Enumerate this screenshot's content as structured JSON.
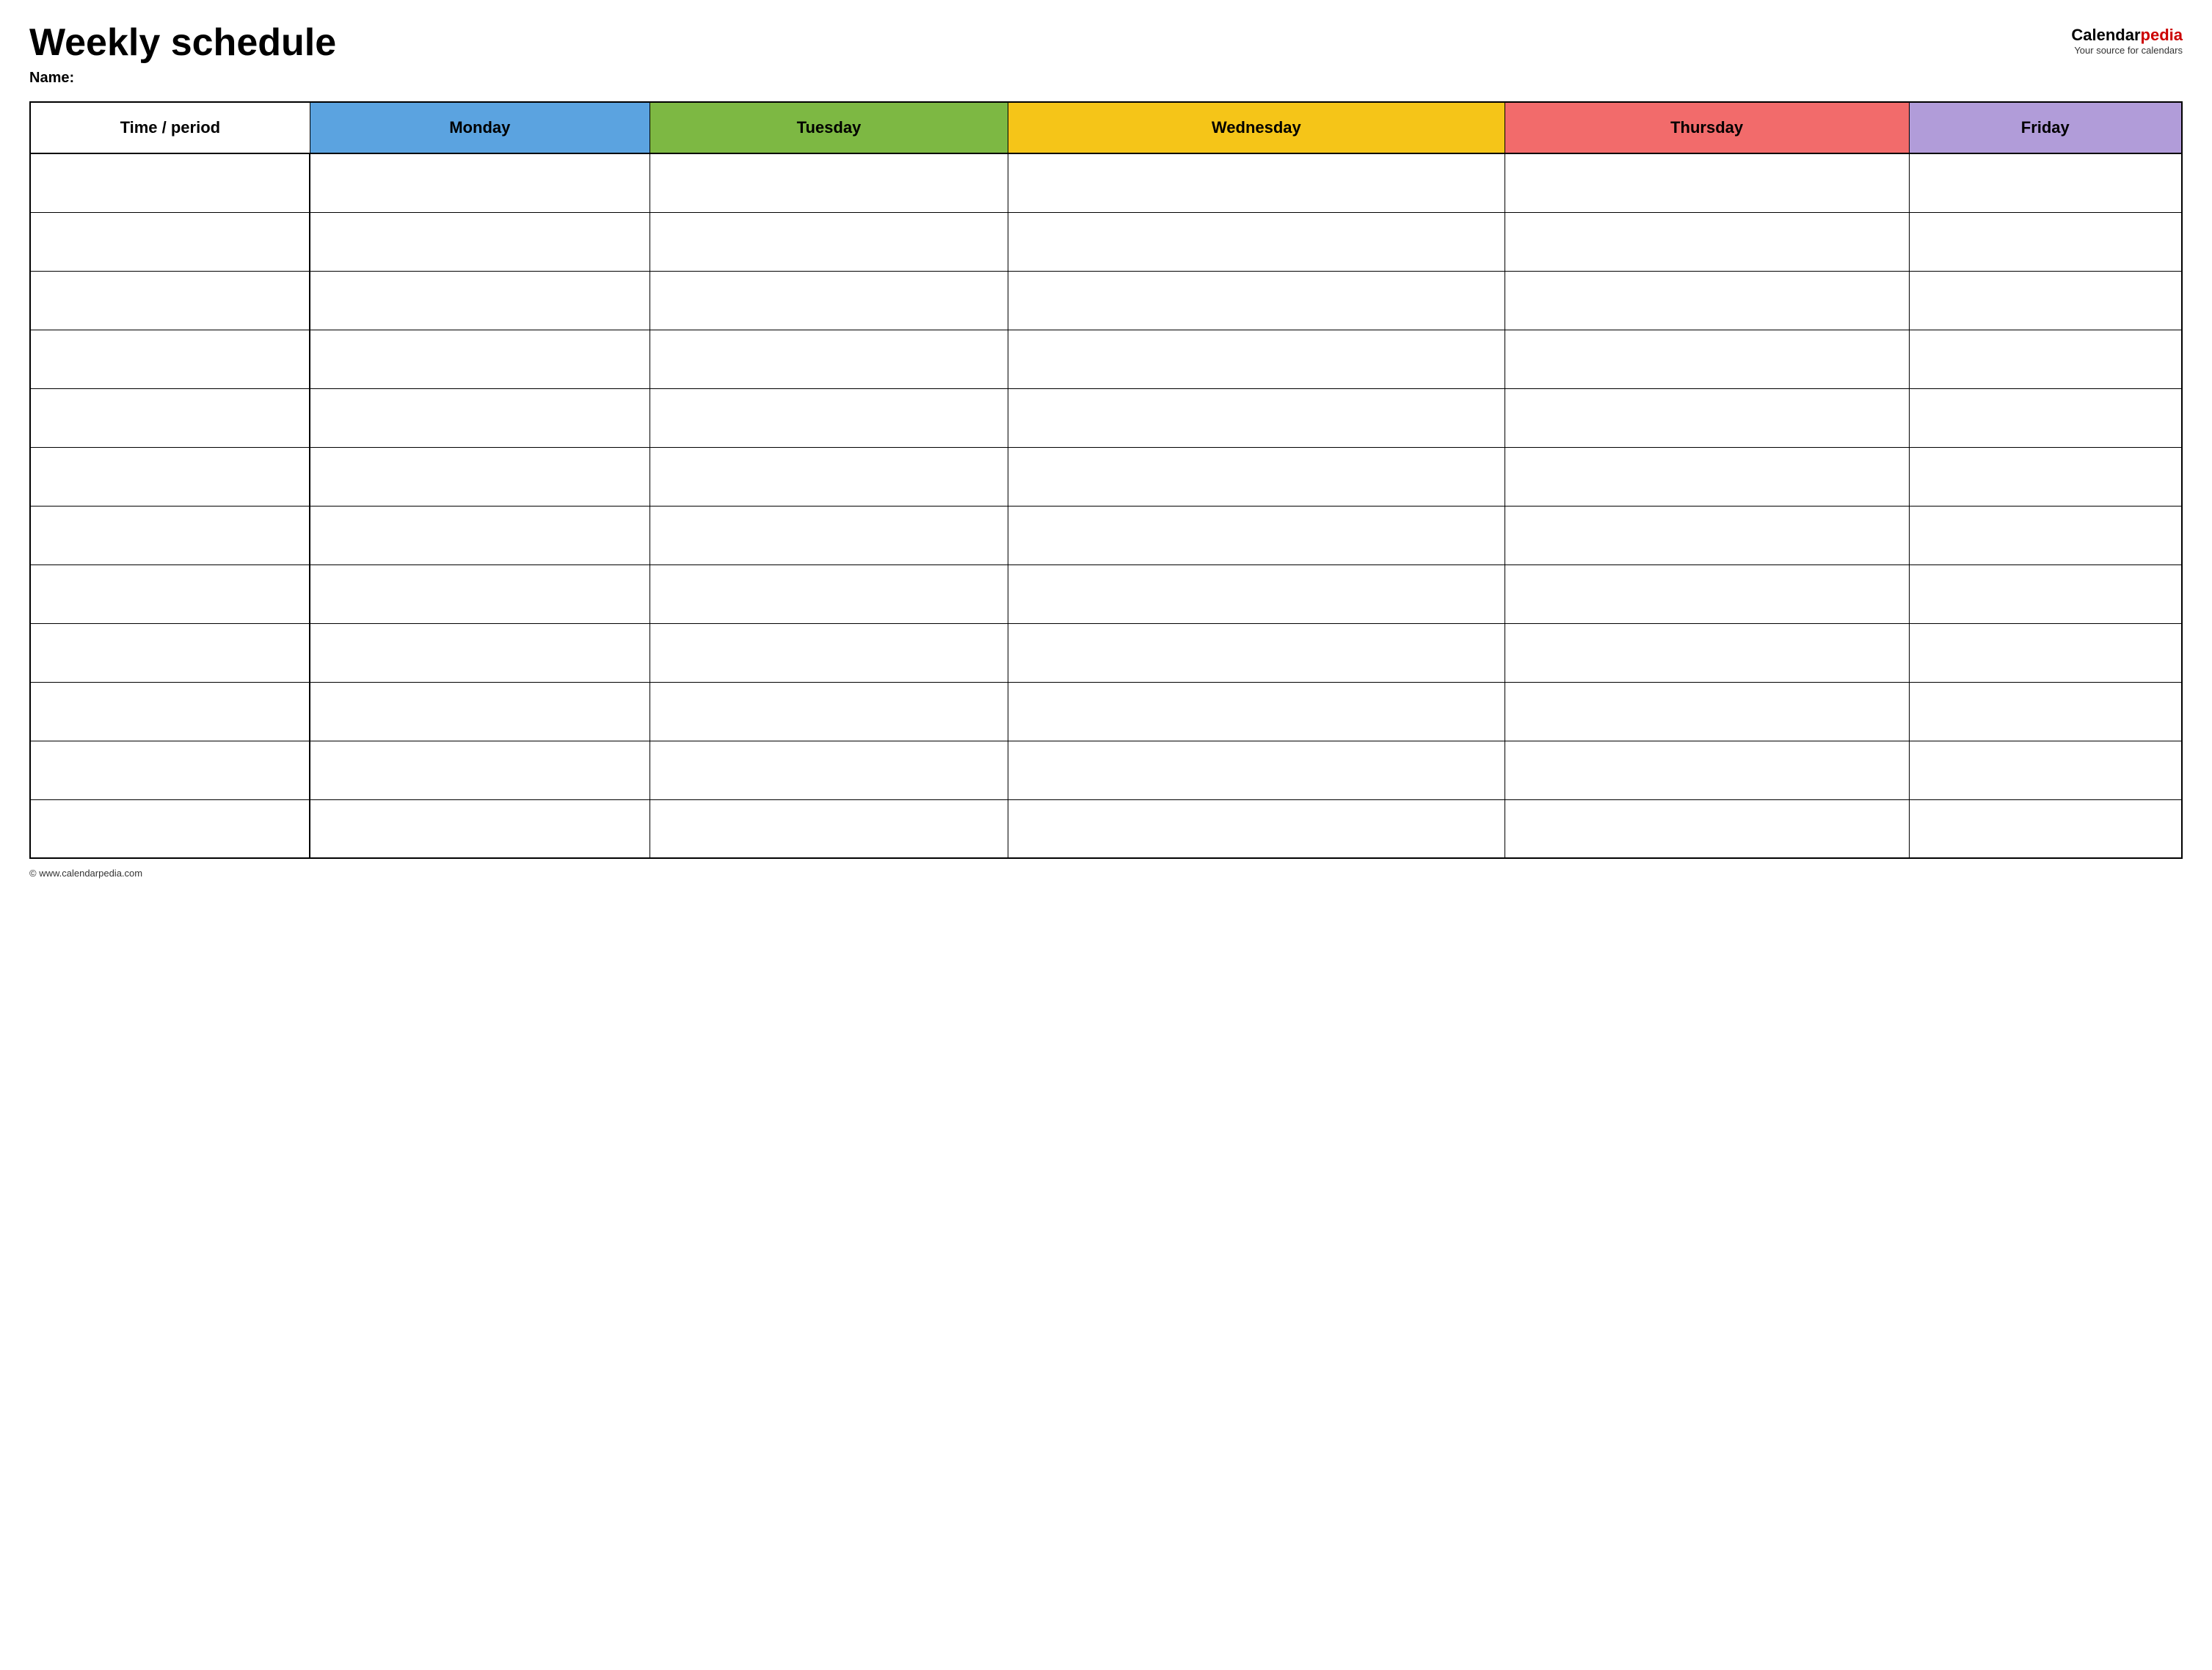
{
  "header": {
    "title": "Weekly schedule",
    "name_label": "Name:",
    "logo": {
      "calendar_text": "Calendar",
      "pedia_text": "pedia",
      "tagline": "Your source for calendars"
    }
  },
  "table": {
    "columns": [
      {
        "id": "time",
        "label": "Time / period",
        "color": "#ffffff",
        "text_color": "#000000"
      },
      {
        "id": "monday",
        "label": "Monday",
        "color": "#5ba3e0",
        "text_color": "#000000"
      },
      {
        "id": "tuesday",
        "label": "Tuesday",
        "color": "#7db843",
        "text_color": "#000000"
      },
      {
        "id": "wednesday",
        "label": "Wednesday",
        "color": "#f5c518",
        "text_color": "#000000"
      },
      {
        "id": "thursday",
        "label": "Thursday",
        "color": "#f26b6b",
        "text_color": "#000000"
      },
      {
        "id": "friday",
        "label": "Friday",
        "color": "#b19cd9",
        "text_color": "#000000"
      }
    ],
    "row_count": 12
  },
  "footer": {
    "url": "© www.calendarpedia.com"
  }
}
